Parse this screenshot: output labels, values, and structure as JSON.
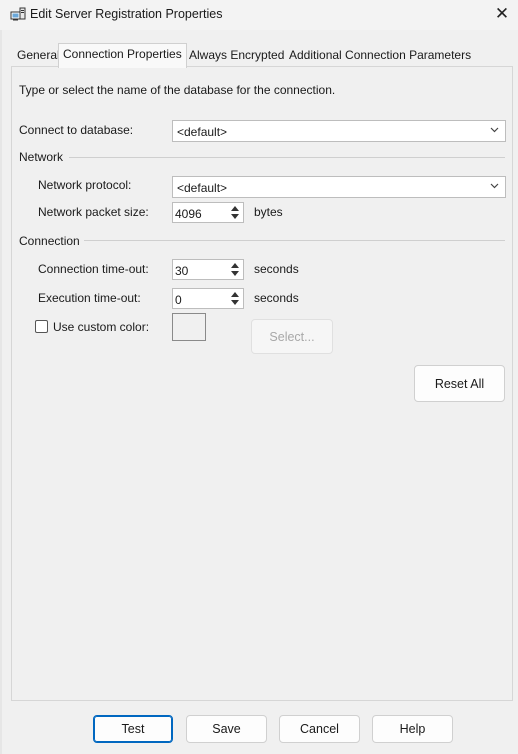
{
  "window": {
    "title": "Edit Server Registration Properties",
    "icon": "server-registration-icon",
    "close_glyph": "✕"
  },
  "tabs": [
    {
      "label": "General",
      "active": false
    },
    {
      "label": "Connection Properties",
      "active": true
    },
    {
      "label": "Always Encrypted",
      "active": false
    },
    {
      "label": "Additional Connection Parameters",
      "active": false
    }
  ],
  "form": {
    "instruction": "Type or select the name of the database for the connection.",
    "connect_to_database": {
      "label": "Connect to database:",
      "value": "<default>"
    },
    "network_group": "Network",
    "network_protocol": {
      "label": "Network protocol:",
      "value": "<default>"
    },
    "network_packet_size": {
      "label": "Network packet size:",
      "value": "4096",
      "unit": "bytes"
    },
    "connection_group": "Connection",
    "connection_timeout": {
      "label": "Connection time-out:",
      "value": "30",
      "unit": "seconds"
    },
    "execution_timeout": {
      "label": "Execution time-out:",
      "value": "0",
      "unit": "seconds"
    },
    "custom_color": {
      "label": "Use custom color:",
      "checked": false
    },
    "select_button": "Select...",
    "reset_all_button": "Reset All"
  },
  "footer": {
    "test": "Test",
    "save": "Save",
    "cancel": "Cancel",
    "help": "Help"
  },
  "colors": {
    "accent": "#0067c0",
    "background": "#f0f0f0"
  }
}
